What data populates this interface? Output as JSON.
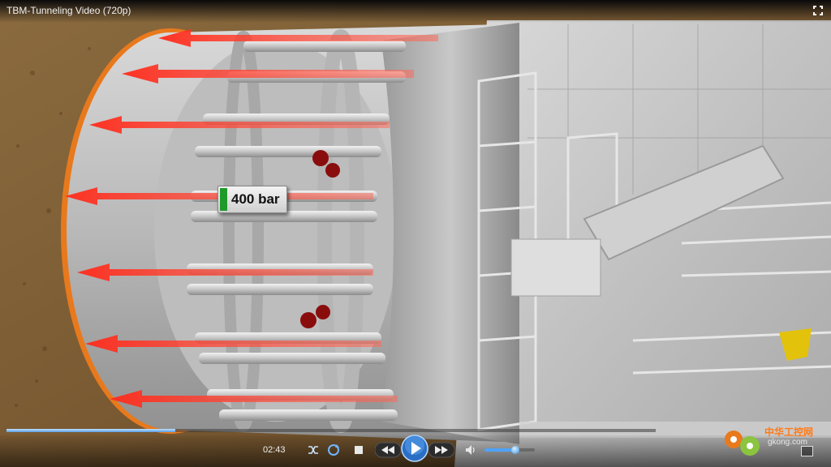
{
  "window": {
    "title": "TBM-Tunneling Video (720p)"
  },
  "video": {
    "overlay_label": "400 bar",
    "progress": 0.26,
    "volume": 0.62
  },
  "controls": {
    "current_time": "02:43",
    "buttons": [
      "shuffle-icon",
      "repeat-icon",
      "stop-icon",
      "previous-icon",
      "play-icon",
      "next-icon",
      "volume-icon"
    ]
  },
  "watermark": {
    "brand": "中华工控网",
    "domain": "gkong.com"
  },
  "colors": {
    "accent": "#4da3ff",
    "arrow_red": "#ff3b30",
    "shield_orange": "#e8791c",
    "label_green": "#1f9a2a"
  }
}
